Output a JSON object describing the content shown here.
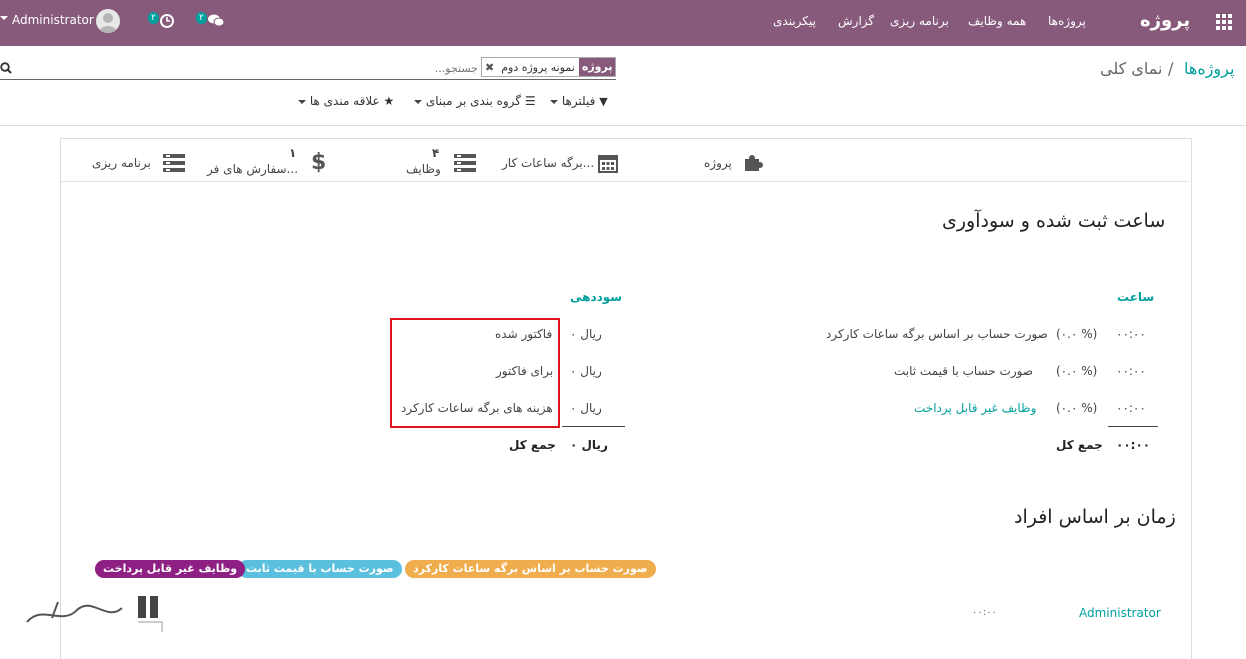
{
  "navbar": {
    "brand": "پروژه",
    "menu": [
      "پروژه‌ها",
      "همه وظایف",
      "برنامه ریزی",
      "گزارش",
      "پیکربندی"
    ],
    "user": "Administrator",
    "activity_count": "۲",
    "messages_count": "۲"
  },
  "breadcrumb": {
    "parent": "پروژه‌ها",
    "separator": "/",
    "current": "نمای کلی"
  },
  "search": {
    "placeholder": "جستجو...",
    "facet_label": "پروژه",
    "facet_value": "نمونه پروژه دوم"
  },
  "controls": {
    "filters": "فیلترها",
    "group_by": "گروه بندی بر مبنای",
    "favorites": "علاقه مندی ها"
  },
  "stat_buttons": [
    {
      "label": "پروژه",
      "icon": "puzzle-icon"
    },
    {
      "label": "برگه ساعات کار...",
      "icon": "calendar-icon"
    },
    {
      "value": "۴",
      "label": "وظایف",
      "icon": "tasks-icon"
    },
    {
      "value": "۱",
      "label": "سفارش های فر...",
      "icon": "dollar-icon"
    },
    {
      "label": "برنامه ریزی",
      "icon": "tasks-icon"
    }
  ],
  "hours_section": {
    "title": "ساعت ثبت شده و سودآوری",
    "hours_header": "ساعت",
    "profit_header": "سوددهی",
    "hours_rows": [
      {
        "value": "۰۰:۰۰",
        "percent": "(۰.۰ %)",
        "label": "صورت حساب بر اساس برگه ساعات کارکرد"
      },
      {
        "value": "۰۰:۰۰",
        "percent": "(۰.۰ %)",
        "label": "صورت حساب با قیمت ثابت"
      },
      {
        "value": "۰۰:۰۰",
        "percent": "(۰.۰ %)",
        "label": "وظایف غیر قابل پرداخت"
      }
    ],
    "hours_total_value": "۰۰:۰۰",
    "hours_total_label": "جمع کل",
    "profit_rows": [
      {
        "value": "۰ ریال",
        "label": "فاکتور شده"
      },
      {
        "value": "۰ ریال",
        "label": "برای فاکتور"
      },
      {
        "value": "۰ ریال",
        "label": "هزینه های برگه ساعات کارکرد"
      }
    ],
    "profit_total_value": "۰ ریال",
    "profit_total_label": "جمع کل"
  },
  "people_section": {
    "title": "زمان بر اساس افراد",
    "legend": [
      {
        "label": "صورت حساب بر اساس برگه ساعات کارکرد",
        "color": "#f0ad4e"
      },
      {
        "label": "صورت حساب با قیمت ثابت",
        "color": "#5bc0de"
      },
      {
        "label": "وظایف غیر قابل پرداخت",
        "color": "#8e1f83"
      }
    ],
    "rows": [
      {
        "name": "Administrator",
        "value": "۰۰:۰۰"
      }
    ]
  },
  "colors": {
    "navbar": "#875a7b",
    "accent": "#00a09d",
    "highlight": "#e0141e"
  }
}
